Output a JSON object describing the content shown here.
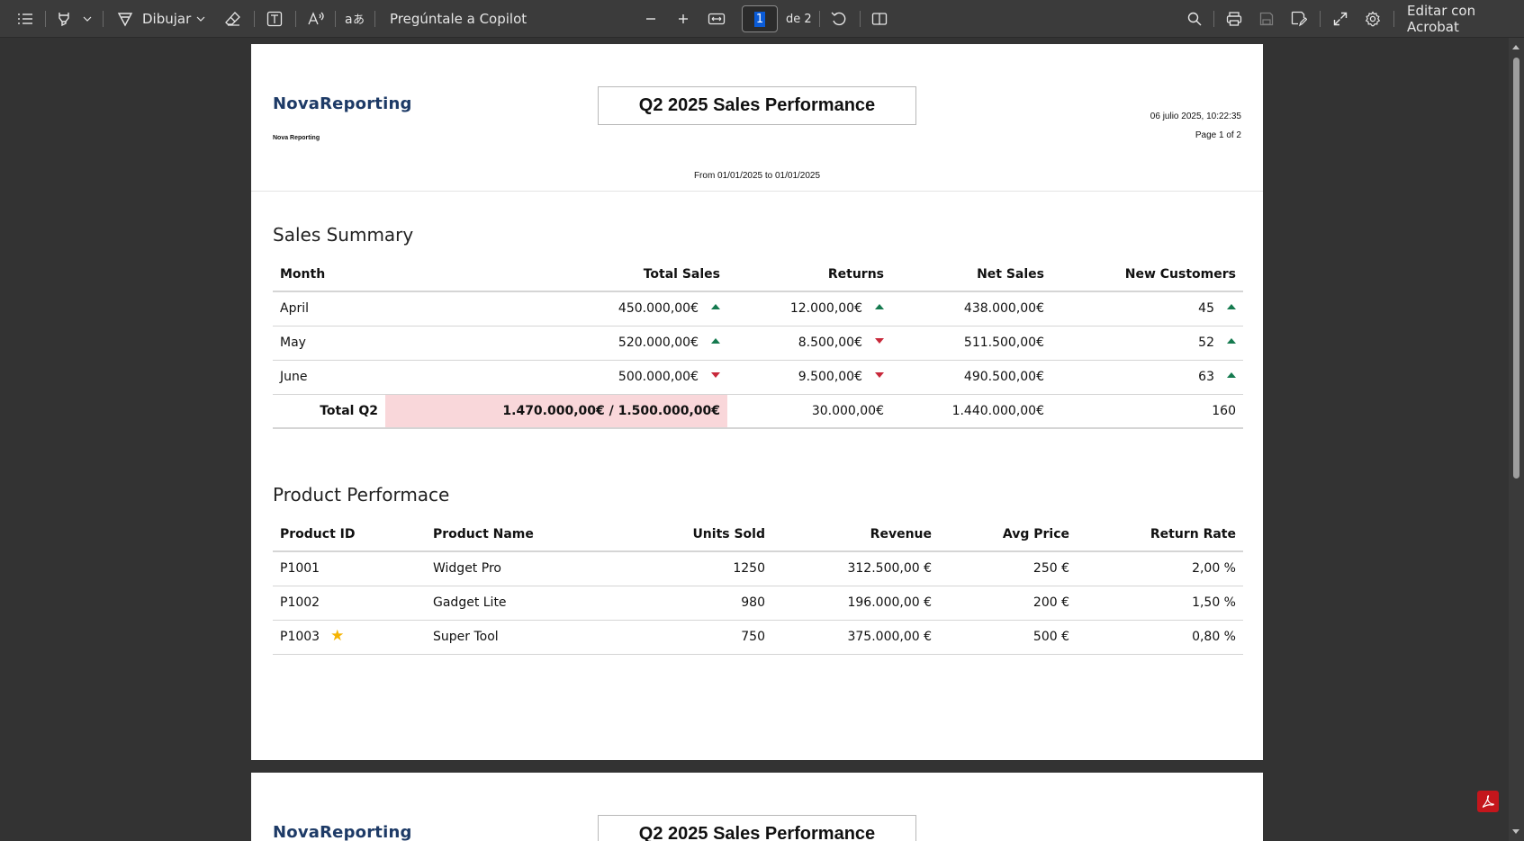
{
  "toolbar": {
    "draw_label": "Dibujar",
    "copilot_label": "Pregúntale a Copilot",
    "page_current": "1",
    "page_total": "de 2",
    "edit_label": "Editar con Acrobat"
  },
  "report": {
    "logo": "NovaReporting",
    "logo_sub": "Nova Reporting",
    "title": "Q2 2025 Sales Performance",
    "date": "06 julio 2025, 10:22:35",
    "page": "Page 1 of 2",
    "range": "From 01/01/2025 to 01/01/2025"
  },
  "sales_summary": {
    "title": "Sales Summary",
    "headers": [
      "Month",
      "Total Sales",
      "Returns",
      "Net Sales",
      "New Customers"
    ],
    "rows": [
      {
        "month": "April",
        "total": "450.000,00€",
        "total_trend": "up",
        "returns": "12.000,00€",
        "returns_trend": "up",
        "net": "438.000,00€",
        "customers": "45",
        "customers_trend": "up"
      },
      {
        "month": "May",
        "total": "520.000,00€",
        "total_trend": "up",
        "returns": "8.500,00€",
        "returns_trend": "down",
        "net": "511.500,00€",
        "customers": "52",
        "customers_trend": "up"
      },
      {
        "month": "June",
        "total": "500.000,00€",
        "total_trend": "down",
        "returns": "9.500,00€",
        "returns_trend": "down",
        "net": "490.500,00€",
        "customers": "63",
        "customers_trend": "up"
      }
    ],
    "total": {
      "label": "Total Q2",
      "total": "1.470.000,00€ / 1.500.000,00€",
      "returns": "30.000,00€",
      "net": "1.440.000,00€",
      "customers": "160"
    }
  },
  "product_performance": {
    "title": "Product Performace",
    "headers": [
      "Product ID",
      "Product Name",
      "Units Sold",
      "Revenue",
      "Avg Price",
      "Return Rate"
    ],
    "rows": [
      {
        "id": "P1001",
        "name": "Widget Pro",
        "units": "1250",
        "revenue": "312.500,00 €",
        "avg": "250 €",
        "rate": "2,00 %",
        "starred": false
      },
      {
        "id": "P1002",
        "name": "Gadget Lite",
        "units": "980",
        "revenue": "196.000,00 €",
        "avg": "200 €",
        "rate": "1,50 %",
        "starred": false
      },
      {
        "id": "P1003",
        "name": "Super Tool",
        "units": "750",
        "revenue": "375.000,00 €",
        "avg": "500 €",
        "rate": "0,80 %",
        "starred": true
      }
    ]
  },
  "colors": {
    "up": "#157a4f",
    "down": "#c8283a",
    "highlight": "#f9d7da",
    "star": "#f5b301"
  }
}
